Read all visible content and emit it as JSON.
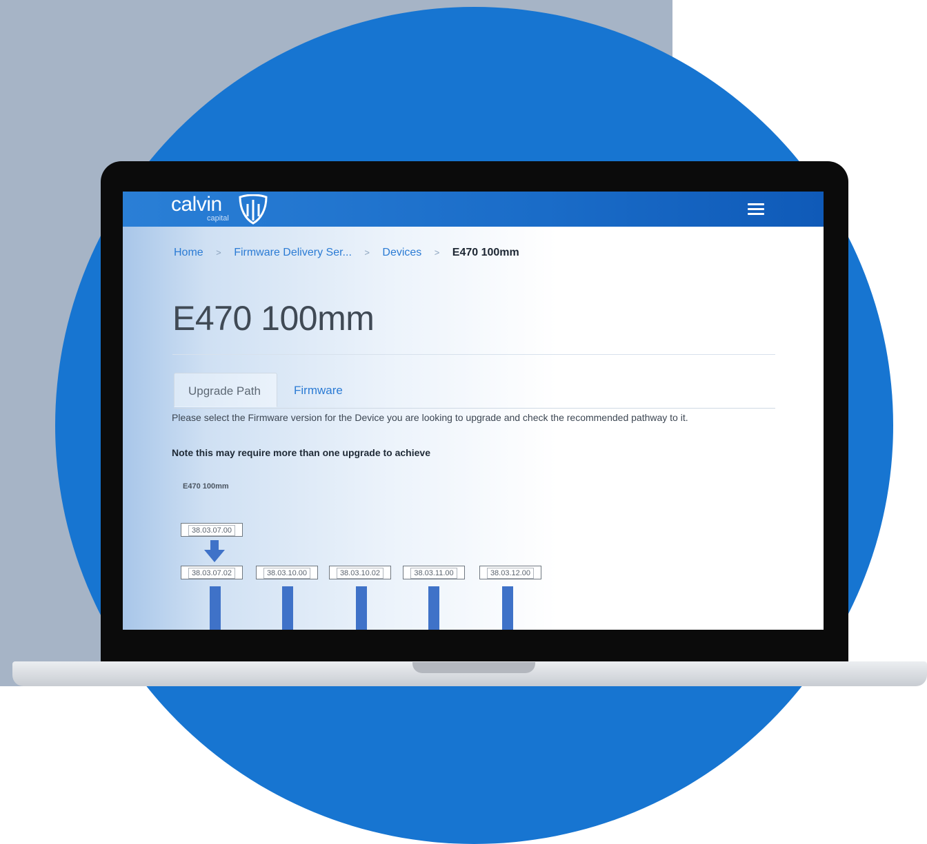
{
  "brand": {
    "name": "calvin",
    "subname": "capital",
    "colors": {
      "primary": "#1775d1",
      "nav": "#1a6cc8",
      "link": "#2b7bd4",
      "stem": "#3f72c8"
    }
  },
  "header": {
    "menu_icon": "hamburger-icon"
  },
  "breadcrumb": {
    "home": "Home",
    "firmware": "Firmware Delivery Ser...",
    "devices": "Devices",
    "current": "E470 100mm",
    "separator": ">"
  },
  "page": {
    "title": "E470 100mm",
    "tabs": [
      {
        "label": "Upgrade Path",
        "active": true
      },
      {
        "label": "Firmware",
        "active": false
      }
    ],
    "intro": "Please select the Firmware version for the Device you are looking to upgrade and check the recommended pathway to it.",
    "note": "Note this may require more than one upgrade to achieve"
  },
  "upgrade_path": {
    "device": "E470 100mm",
    "start_version": "38.03.07.00",
    "versions": [
      "38.03.07.02",
      "38.03.10.00",
      "38.03.10.02",
      "38.03.11.00",
      "38.03.12.00"
    ]
  }
}
